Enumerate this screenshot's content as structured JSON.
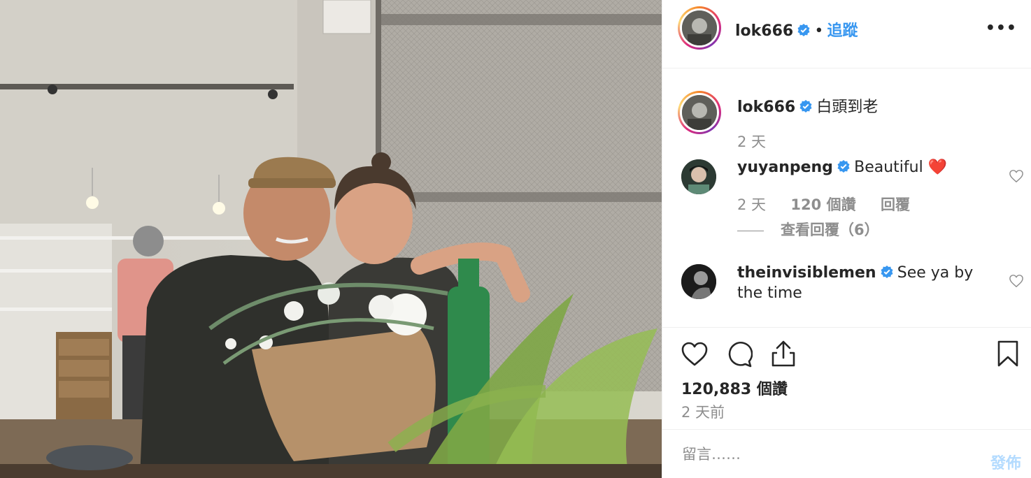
{
  "post": {
    "username": "lok666",
    "follow_label": "追蹤",
    "separator": "•",
    "more_label": "•••",
    "caption": "白頭到老",
    "caption_time": "2 天",
    "likes_text": "120,883 個讚",
    "time_ago": "2 天前"
  },
  "comments": [
    {
      "username": "yuyanpeng",
      "text": "Beautiful ❤️",
      "time": "2 天",
      "likes": "120 個讚",
      "reply_label": "回覆",
      "view_replies": "查看回覆（6）"
    },
    {
      "username": "theinvisiblemen",
      "text": "See ya by",
      "text_line2": "the time"
    }
  ],
  "comment_box": {
    "placeholder": "留言……",
    "post_label": "發佈"
  },
  "colors": {
    "link": "#3897f0",
    "muted": "#8e8e8e",
    "post_disabled": "#b3dbff",
    "verified": "#3897f0"
  },
  "icons": [
    "verified-badge-icon",
    "more-options-icon",
    "heart-icon",
    "comment-icon",
    "share-icon",
    "bookmark-icon",
    "small-heart-icon"
  ]
}
